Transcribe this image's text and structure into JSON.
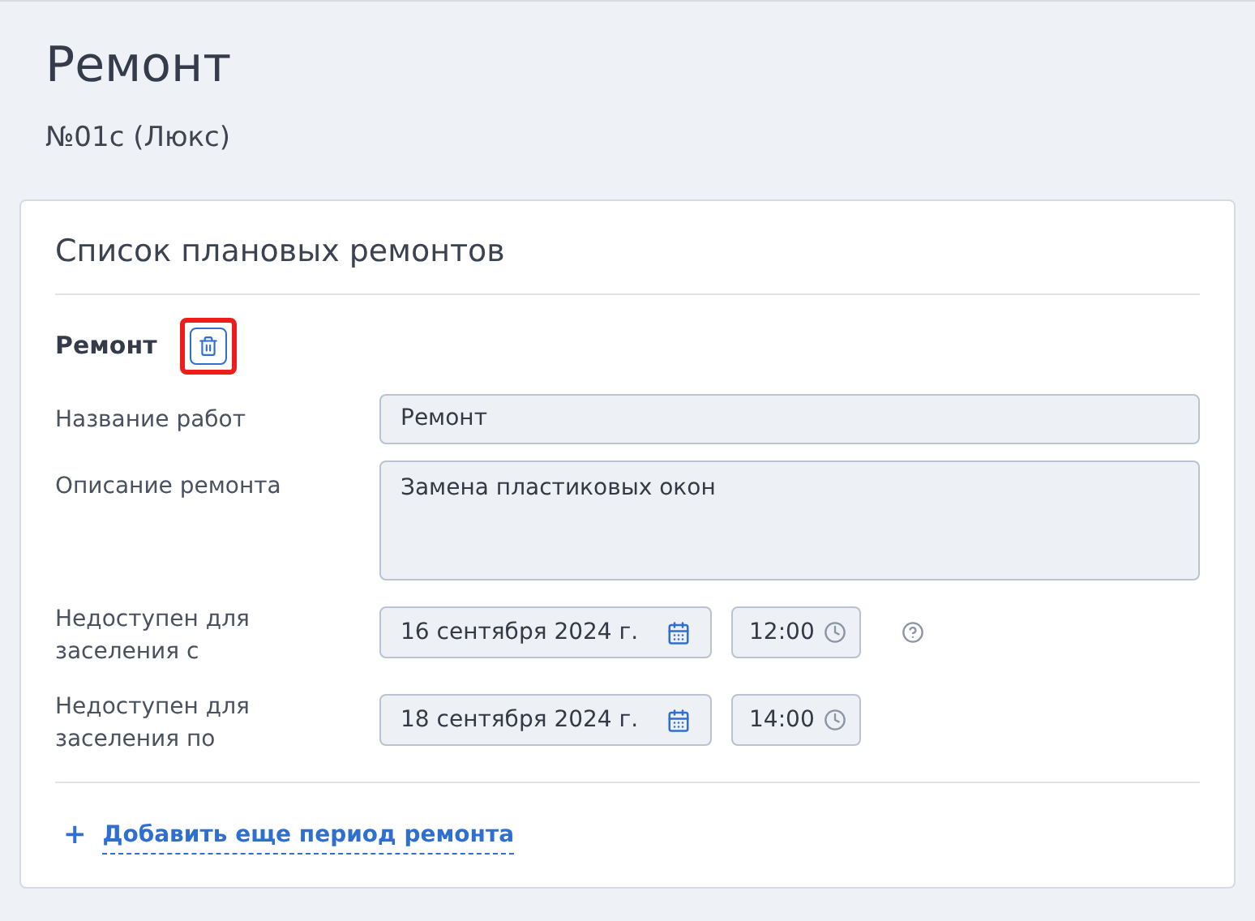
{
  "page": {
    "title": "Ремонт",
    "subtitle": "№01с (Люкс)"
  },
  "card": {
    "title": "Список плановых ремонтов",
    "section": {
      "title": "Ремонт",
      "delete_highlighted": true
    },
    "fields": [
      {
        "kind": "text",
        "label": "Название работ",
        "value": "Ремонт"
      },
      {
        "kind": "textarea",
        "label": "Описание ремонта",
        "value": "Замена пластиковых окон"
      },
      {
        "kind": "datetime",
        "label": "Недоступен для заселения с",
        "date": "16 сентября 2024 г.",
        "time": "12:00",
        "help": true
      },
      {
        "kind": "datetime",
        "label": "Недоступен для заселения по",
        "date": "18 сентября 2024 г.",
        "time": "14:00",
        "help": false
      }
    ],
    "add_link": {
      "icon": "+",
      "label": "Добавить еще период ремонта"
    }
  }
}
